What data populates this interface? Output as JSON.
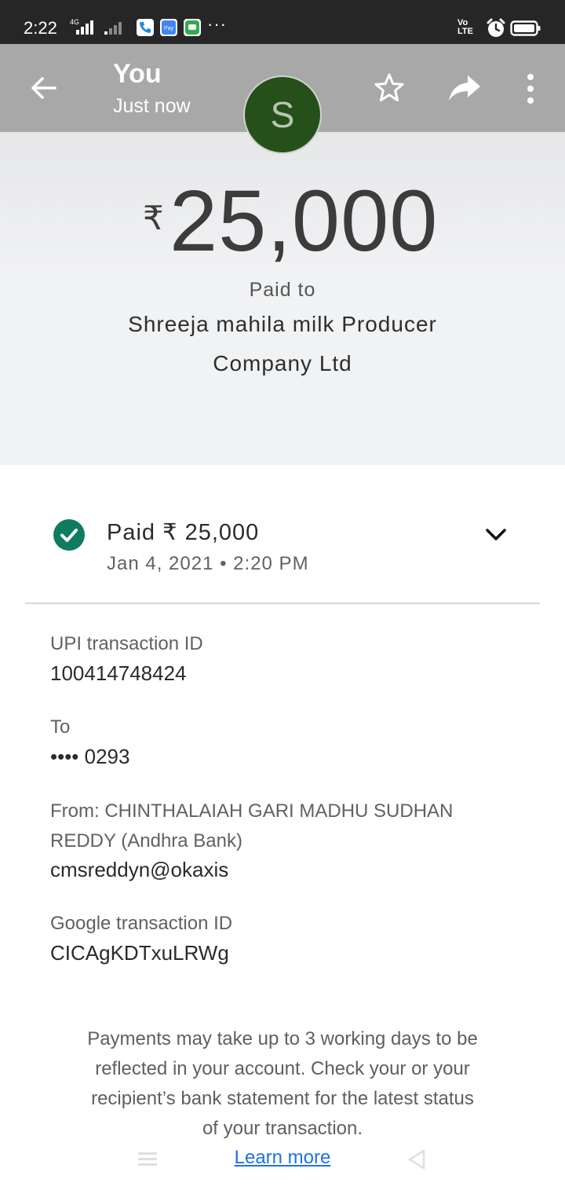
{
  "status_bar": {
    "time": "2:22",
    "network": "4G",
    "volte": "Vo LTE",
    "icons": [
      "phone-app-icon",
      "pay-app-icon",
      "messages-app-icon",
      "more-dots",
      "alarm-icon",
      "battery-icon"
    ]
  },
  "header": {
    "title": "You",
    "subtitle": "Just now",
    "avatar_letter": "S",
    "avatar_color": "#25501a"
  },
  "hero": {
    "currency_symbol": "₹",
    "amount": "25,000",
    "paid_to_label": "Paid to",
    "payee": "Shreeja mahila milk Producer Company Ltd"
  },
  "summary": {
    "status": "Paid ₹ 25,000",
    "datetime": "Jan 4, 2021 • 2:20 PM",
    "status_color": "#0f7b5f"
  },
  "details": {
    "upi_label": "UPI transaction ID",
    "upi_value": "100414748424",
    "to_label": "To",
    "to_value": "•••• 0293",
    "from_label": "From: CHINTHALAIAH GARI MADHU SUDHAN REDDY (Andhra Bank)",
    "from_value": "cmsreddyn@okaxis",
    "google_label": "Google transaction ID",
    "google_value": "CICAgKDTxuLRWg"
  },
  "footer": {
    "note": "Payments may take up to 3 working days to be reflected in your account. Check your or your recipient’s bank statement for the latest status of your transaction.",
    "learn_more": "Learn more"
  }
}
